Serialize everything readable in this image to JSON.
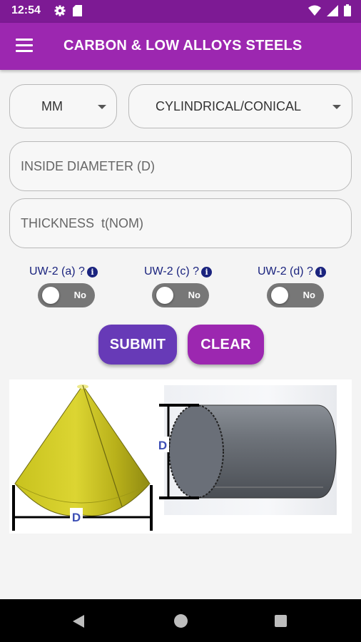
{
  "status_bar": {
    "time": "12:54",
    "icons": [
      "gear-icon",
      "sd-card-icon",
      "wifi-icon",
      "signal-icon",
      "battery-icon"
    ]
  },
  "app_bar": {
    "title": "CARBON & LOW ALLOYS STEELS",
    "menu_icon": "hamburger-menu-icon"
  },
  "form": {
    "unit_select": {
      "value": "MM"
    },
    "shape_select": {
      "value": "CYLINDRICAL/CONICAL"
    },
    "inside_diameter": {
      "placeholder": "INSIDE DIAMETER (D)",
      "value": ""
    },
    "thickness": {
      "placeholder": "THICKNESS  t(NOM)",
      "value": ""
    },
    "toggles": [
      {
        "label": "UW-2 (a) ?",
        "state": "No"
      },
      {
        "label": "UW-2 (c) ?",
        "state": "No"
      },
      {
        "label": "UW-2 (d) ?",
        "state": "No"
      }
    ],
    "submit_label": "SUBMIT",
    "clear_label": "CLEAR"
  },
  "illustration": {
    "cone_label": "D",
    "cylinder_label": "D"
  },
  "colors": {
    "status_bar": "#7d1a94",
    "app_bar": "#9c27b0",
    "submit_button": "#673ab7",
    "clear_button": "#9c27b0",
    "label_text": "#1a237e"
  }
}
